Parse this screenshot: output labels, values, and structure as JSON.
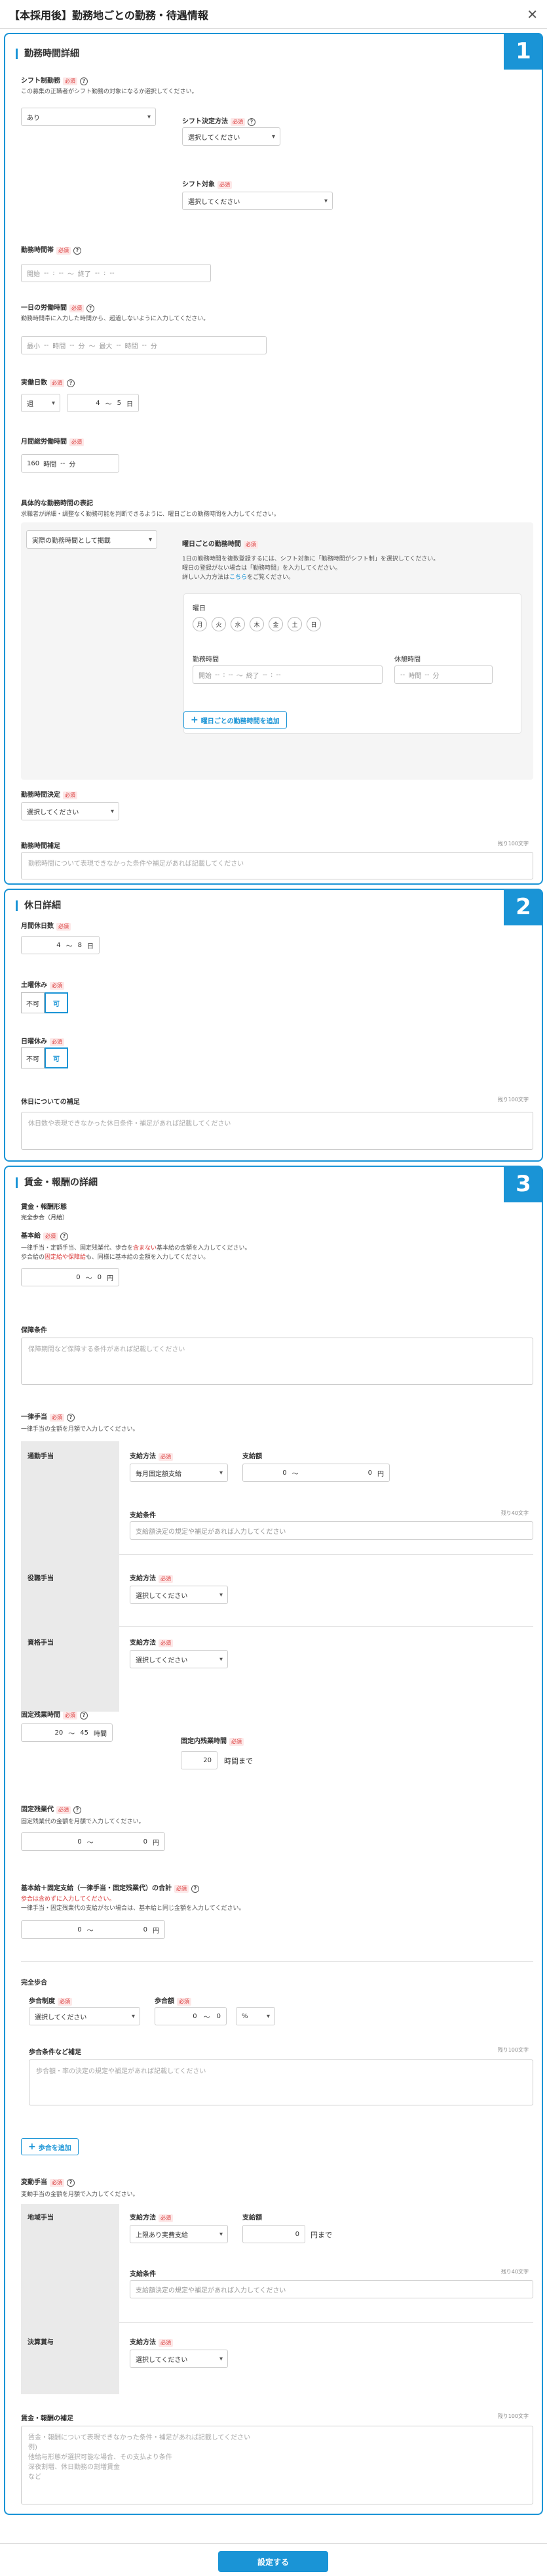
{
  "header": {
    "title": "【本採用後】勤務地ごとの勤務・待遇情報",
    "close": "✕"
  },
  "footer": {
    "submit": "設定する"
  },
  "s1": {
    "badge": "1",
    "title": "勤務時間詳細",
    "shift": {
      "label": "シフト制勤務",
      "req": "必須",
      "desc": "この募集の正職者がシフト勤務の対象になるか選択してください。",
      "value": "あり"
    },
    "shift_method": {
      "label": "シフト決定方法",
      "req": "必須",
      "value": "選択してください"
    },
    "shift_target": {
      "label": "シフト対象",
      "req": "必須",
      "value": "選択してください"
    },
    "work_time": {
      "label": "勤務時間帯",
      "req": "必須",
      "start": "開始",
      "end": "終了",
      "dash": "--",
      "colon": ":",
      "tilde": "〜"
    },
    "daily": {
      "label": "一日の労働時間",
      "req": "必須",
      "desc": "勤務時間帯に入力した時間から、超過しないように入力してください。",
      "min": "最小",
      "max": "最大",
      "unit_h": "時間",
      "unit_m": "分",
      "tilde": "〜"
    },
    "days": {
      "label": "実働日数",
      "req": "必須",
      "period": "週",
      "from": "4",
      "to": "5",
      "unit": "日",
      "tilde": "〜"
    },
    "monthly": {
      "label": "月間総労働時間",
      "req": "必須",
      "hours": "160",
      "unit_h": "時間",
      "unit_m": "分",
      "dash": "--"
    },
    "specific": {
      "label": "具体的な勤務時間の表記",
      "desc": "求職者が詳細・調整なく勤務可能を判断できるように、曜日ごとの勤務時間を入力してください。",
      "value": "実際の勤務時間として掲載"
    },
    "dow": {
      "label": "曜日ごとの勤務時間",
      "req": "必須",
      "desc1": "1日の勤務時間を複数登録するには、シフト対象に「勤務時間がシフト制」を選択してください。",
      "desc2": "曜日の登録がない場合は「勤務時間」を入力してください。",
      "desc3_a": "詳しい入力方法は",
      "desc3_link": "こちら",
      "desc3_b": "をご覧ください。",
      "days_label": "曜日",
      "days": [
        "月",
        "火",
        "水",
        "木",
        "金",
        "土",
        "日"
      ],
      "time_label": "勤務時間",
      "break_label": "休憩時間",
      "add": "曜日ごとの勤務時間を追加"
    },
    "decision": {
      "label": "勤務時間決定",
      "req": "必須",
      "value": "選択してください"
    },
    "note": {
      "label": "勤務時間補足",
      "count": "残り100文字",
      "placeholder": "勤務時間について表現できなかった条件や補足があれば記載してください"
    }
  },
  "s2": {
    "badge": "2",
    "title": "休日詳細",
    "monthly": {
      "label": "月間休日数",
      "req": "必須",
      "from": "4",
      "to": "8",
      "unit": "日",
      "tilde": "〜"
    },
    "sat": {
      "label": "土曜休み",
      "req": "必須",
      "no": "不可",
      "yes": "可"
    },
    "sun": {
      "label": "日曜休み",
      "req": "必須",
      "no": "不可",
      "yes": "可"
    },
    "note": {
      "label": "休日についての補足",
      "count": "残り100文字",
      "placeholder": "休日数や表現できなかった休日条件・補足があれば記載してください"
    }
  },
  "s3": {
    "badge": "3",
    "title": "賃金・報酬の詳細",
    "pay_type": {
      "label": "賃金・報酬形態",
      "value": "完全歩合（月給）"
    },
    "base": {
      "label": "基本給",
      "req": "必須",
      "desc1_a": "一律手当・定額手当、固定残業代、歩合を",
      "desc1_red": "含まない",
      "desc1_b": "基本給の金額を入力してください。",
      "desc2_a": "歩合給の",
      "desc2_red": "固定給や保障給",
      "desc2_b": "も、同様に基本給の金額を入力してください。",
      "from": "0",
      "to": "0",
      "unit": "円",
      "tilde": "〜"
    },
    "guarantee": {
      "label": "保障条件",
      "placeholder": "保障期間など保障する条件があれば記載してください"
    },
    "allowance": {
      "label": "一律手当",
      "req": "必須",
      "desc": "一律手当の金額を月額で入力してください。",
      "commute": {
        "label": "通勤手当",
        "method_label": "支給方法",
        "req": "必須",
        "method": "毎月固定額支給",
        "amount_label": "支給額",
        "from": "0",
        "to": "0",
        "unit": "円",
        "tilde": "〜",
        "cond_label": "支給条件",
        "count": "残り40文字",
        "cond_placeholder": "支給額決定の規定や補足があれば入力してください"
      },
      "position": {
        "label": "役職手当",
        "method_label": "支給方法",
        "req": "必須",
        "method": "選択してください"
      },
      "qual": {
        "label": "資格手当",
        "method_label": "支給方法",
        "req": "必須",
        "method": "選択してください"
      }
    },
    "fixed_ot": {
      "label": "固定残業時間",
      "req": "必須",
      "from": "20",
      "to": "45",
      "unit": "時間",
      "tilde": "〜",
      "limit_label": "固定内残業時間",
      "req2": "必須",
      "limit": "20",
      "limit_unit": "時間まで"
    },
    "fixed_ot_pay": {
      "label": "固定残業代",
      "req": "必須",
      "desc": "固定残業代の金額を月額で入力してください。",
      "from": "0",
      "to": "0",
      "unit": "円",
      "tilde": "〜"
    },
    "total": {
      "label": "基本給＋固定支給（一律手当・固定残業代）の合計",
      "req": "必須",
      "desc_red": "歩合は含めずに入力してください。",
      "desc": "一律手当・固定残業代の支給がない場合は、基本給と同じ金額を入力してください。",
      "from": "0",
      "to": "0",
      "unit": "円",
      "tilde": "〜"
    },
    "commission": {
      "label": "完全歩合",
      "sys_label": "歩合制度",
      "req": "必須",
      "sys": "選択してください",
      "rate_label": "歩合額",
      "rate_from": "0",
      "rate_to": "0",
      "rate_unit": "%",
      "tilde": "〜",
      "cond_label": "歩合条件など補足",
      "count": "残り100文字",
      "cond_placeholder": "歩合額・率の決定の規定や補足があれば記載してください",
      "add": "歩合を追加"
    },
    "variable": {
      "label": "変動手当",
      "req": "必須",
      "desc": "変動手当の金額を月額で入力してください。",
      "area": {
        "label": "地域手当",
        "method_label": "支給方法",
        "req": "必須",
        "method": "上限あり実費支給",
        "amount_label": "支給額",
        "amount": "0",
        "unit": "円まで",
        "cond_label": "支給条件",
        "count": "残り40文字",
        "cond_placeholder": "支給額決定の規定や補足があれば入力してください"
      },
      "bonus": {
        "label": "決算賞与",
        "method_label": "支給方法",
        "req": "必須",
        "method": "選択してください"
      }
    },
    "note": {
      "label": "賃金・報酬の補足",
      "count": "残り100文字",
      "placeholder": "賃金・報酬について表現できなかった条件・補足があれば記載してください\n例)\n他給与形態が選択可能な場合、その支払より条件\n深夜割増、休日勤務の割増賃金\nなど"
    }
  }
}
